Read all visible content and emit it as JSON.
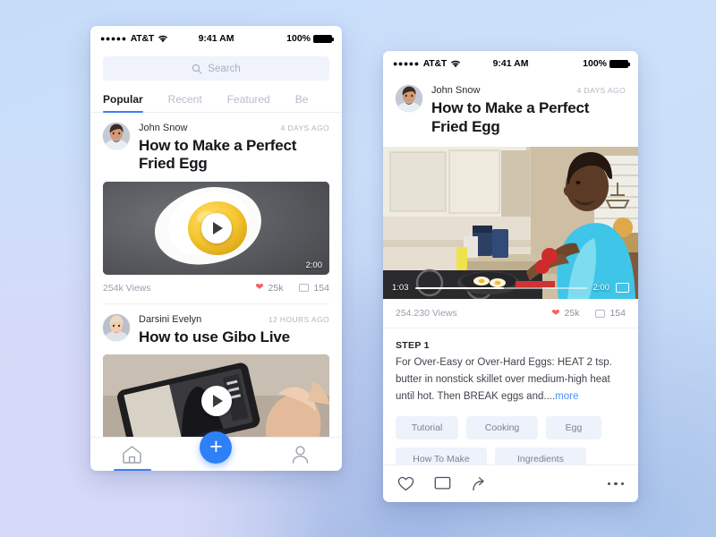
{
  "background": {
    "base_color": "#c6dcf9",
    "accent_color": "#8fadde"
  },
  "theme": {
    "accent": "#3d7ef5",
    "fab": "#2f80f7",
    "heart": "#ff5a5f",
    "link": "#4d8ef7",
    "chip_bg": "#eef2fb"
  },
  "phone_list": {
    "status_bar": {
      "signal_dots": "●●●●●",
      "carrier": "AT&T",
      "wifi_icon": "wifi-icon",
      "time": "9:41 AM",
      "battery_percent": "100%"
    },
    "search": {
      "placeholder": "Search",
      "icon": "search-icon"
    },
    "tabs": [
      {
        "label": "Popular",
        "active": true
      },
      {
        "label": "Recent",
        "active": false
      },
      {
        "label": "Featured",
        "active": false
      },
      {
        "label": "Be",
        "active": false
      }
    ],
    "posts": [
      {
        "author": "John Snow",
        "ago": "4 DAYS AGO",
        "title": "How to Make a Perfect Fried Egg",
        "thumbnail": "fried-egg-photo",
        "duration": "2:00",
        "views": "254k Views",
        "likes": "25k",
        "comments": "154"
      },
      {
        "author": "Darsini Evelyn",
        "ago": "12 HOURS AGO",
        "title": "How to use Gibo Live",
        "thumbnail": "hand-holding-phone-photo",
        "duration": "",
        "views": "",
        "likes": "",
        "comments": ""
      }
    ],
    "tabbar": [
      {
        "name": "home-icon",
        "label": "Home",
        "active": true
      },
      {
        "name": "plus-icon",
        "label": "+",
        "active": false
      },
      {
        "name": "profile-icon",
        "label": "Profile",
        "active": false
      }
    ]
  },
  "phone_detail": {
    "status_bar": {
      "signal_dots": "●●●●●",
      "carrier": "AT&T",
      "wifi_icon": "wifi-icon",
      "time": "9:41 AM",
      "battery_percent": "100%"
    },
    "header": {
      "author": "John Snow",
      "ago": "4 DAYS AGO",
      "title": "How to Make a Perfect Fried Egg"
    },
    "player": {
      "image": "man-cooking-eggs-in-kitchen-photo",
      "current_time": "1:03",
      "total_time": "2:00",
      "progress_percent": 52,
      "fullscreen_icon": "fullscreen-icon"
    },
    "stats": {
      "views": "254.230 Views",
      "likes": "25k",
      "comments": "154"
    },
    "step": {
      "label": "STEP 1",
      "body": "For Over-Easy or Over-Hard Eggs: HEAT 2 tsp. butter in nonstick skillet over medium-high heat until hot. Then BREAK eggs and....",
      "more_label": "more"
    },
    "tags": [
      "Tutorial",
      "Cooking",
      "Egg",
      "How To Make",
      "Ingredients"
    ],
    "actionbar": {
      "like_icon": "heart-outline-icon",
      "comment_icon": "comment-icon",
      "share_icon": "share-arrow-icon",
      "overflow_icon": "more-horizontal-icon"
    }
  }
}
